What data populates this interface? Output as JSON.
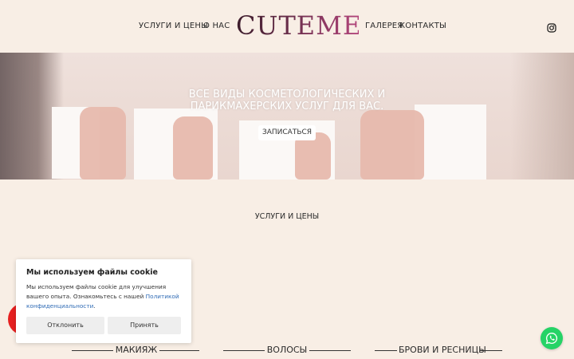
{
  "header": {
    "nav_left": [
      "УСЛУГИ И ЦЕНЫ",
      "О НАС"
    ],
    "logo": "CUTEME",
    "nav_right": [
      "ГАЛЕРЕЯ",
      "КОНТАКТЫ"
    ],
    "social_icon": "instagram-icon"
  },
  "hero": {
    "headline_line1": "ВСЕ ВИДЫ КОСМЕТОЛОГИЧЕСКИХ И",
    "headline_line2": "ПАРИКМАХЕРСКИХ УСЛУГ ДЛЯ ВАС.",
    "cta_label": "ЗАПИСАТЬСЯ"
  },
  "services": {
    "title": "УСЛУГИ И ЦЕНЫ",
    "categories": [
      "МАКИЯЖ",
      "ВОЛОСЫ",
      "БРОВИ И РЕСНИЦЫ"
    ]
  },
  "cookie": {
    "title": "Мы используем файлы cookie",
    "text_before": "Мы используем файлы cookie для улучшения вашего опыта. Ознакомьтесь с нашей ",
    "link_text": "Политикой конфиденциальности",
    "text_after": ".",
    "decline_label": "Отклонить",
    "accept_label": "Принять"
  },
  "widgets": {
    "chat_icon": "whatsapp-icon"
  },
  "colors": {
    "page_background": "#f8eee5",
    "logo_gradient_start": "#3d1d2c",
    "logo_gradient_end": "#b2457b",
    "link": "#2f6bb5",
    "whatsapp": "#25d366"
  }
}
